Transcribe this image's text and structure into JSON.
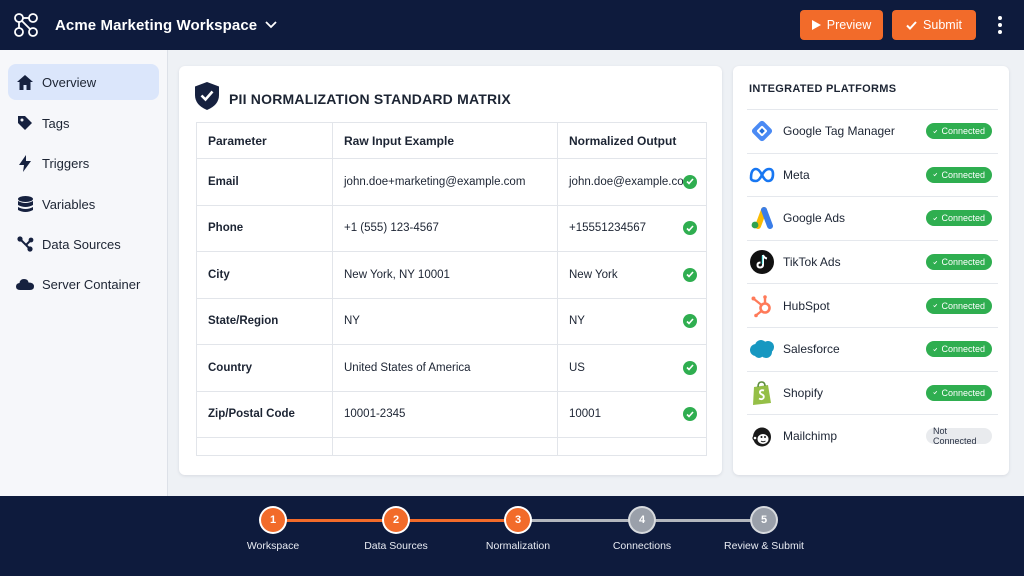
{
  "app": {
    "workspace_title": "Acme Marketing Workspace",
    "preview_label": "Preview",
    "submit_label": "Submit",
    "accent_color": "#f26b2a",
    "nav_bg": "#0e1b3d"
  },
  "sidebar": {
    "items": [
      {
        "label": "Overview",
        "icon": "home-icon",
        "active": true
      },
      {
        "label": "Tags",
        "icon": "tag-icon",
        "active": false
      },
      {
        "label": "Triggers",
        "icon": "lightning-icon",
        "active": false
      },
      {
        "label": "Variables",
        "icon": "database-icon",
        "active": false
      },
      {
        "label": "Data Sources",
        "icon": "share-nodes-icon",
        "active": false
      },
      {
        "label": "Server Container",
        "icon": "cloud-icon",
        "active": false
      }
    ]
  },
  "matrix": {
    "title": "PII NORMALIZATION STANDARD MATRIX",
    "columns": [
      "Parameter",
      "Raw Input Example",
      "Normalized Output"
    ],
    "rows": [
      {
        "parameter": "Email",
        "raw": "john.doe+marketing@example.com",
        "normalized": "john.doe@example.com",
        "valid": true
      },
      {
        "parameter": "Phone",
        "raw": "+1 (555) 123-4567",
        "normalized": "+15551234567",
        "valid": true
      },
      {
        "parameter": "City",
        "raw": "New York, NY 10001",
        "normalized": "New York",
        "valid": true
      },
      {
        "parameter": "State/Region",
        "raw": "NY",
        "normalized": "NY",
        "valid": true
      },
      {
        "parameter": "Country",
        "raw": "United States of America",
        "normalized": "US",
        "valid": true
      },
      {
        "parameter": "Zip/Postal Code",
        "raw": "10001-2345",
        "normalized": "10001",
        "valid": true
      }
    ]
  },
  "platforms": {
    "heading": "INTEGRATED PLATFORMS",
    "items": [
      {
        "name": "Google Tag Manager",
        "status": "Connected",
        "connected": true,
        "icon": "google-tag-manager-icon"
      },
      {
        "name": "Meta",
        "status": "Connected",
        "connected": true,
        "icon": "meta-icon"
      },
      {
        "name": "Google Ads",
        "status": "Connected",
        "connected": true,
        "icon": "google-ads-icon"
      },
      {
        "name": "TikTok Ads",
        "status": "Connected",
        "connected": true,
        "icon": "tiktok-icon"
      },
      {
        "name": "HubSpot",
        "status": "Connected",
        "connected": true,
        "icon": "hubspot-icon"
      },
      {
        "name": "Salesforce",
        "status": "Connected",
        "connected": true,
        "icon": "salesforce-icon"
      },
      {
        "name": "Shopify",
        "status": "Connected",
        "connected": true,
        "icon": "shopify-icon"
      },
      {
        "name": "Mailchimp",
        "status": "Not Connected",
        "connected": false,
        "icon": "mailchimp-icon"
      }
    ]
  },
  "stepper": {
    "steps": [
      {
        "number": "1",
        "label": "Workspace",
        "done": true
      },
      {
        "number": "2",
        "label": "Data Sources",
        "done": true
      },
      {
        "number": "3",
        "label": "Normalization",
        "done": true
      },
      {
        "number": "4",
        "label": "Connections",
        "done": false
      },
      {
        "number": "5",
        "label": "Review & Submit",
        "done": false
      }
    ]
  }
}
